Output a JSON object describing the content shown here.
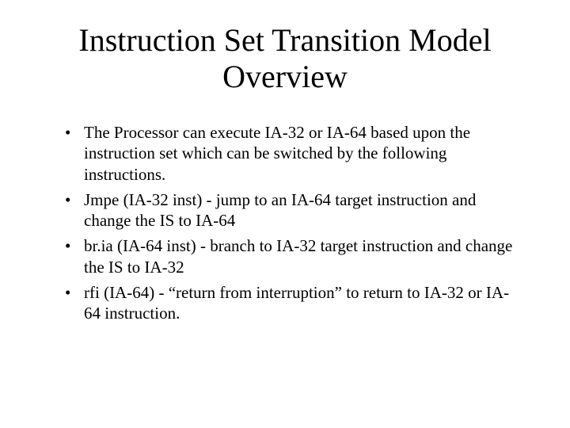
{
  "slide": {
    "title": "Instruction Set Transition Model Overview",
    "bullets": [
      "The Processor can execute IA-32 or IA-64 based upon the instruction set which can be switched by the following instructions.",
      "Jmpe (IA-32 inst) - jump to an IA-64 target instruction and change the IS to IA-64",
      "br.ia (IA-64 inst) - branch to IA-32 target instruction and change the IS to IA-32",
      "rfi (IA-64) - “return from interruption” to return to IA-32 or IA-64 instruction."
    ]
  }
}
